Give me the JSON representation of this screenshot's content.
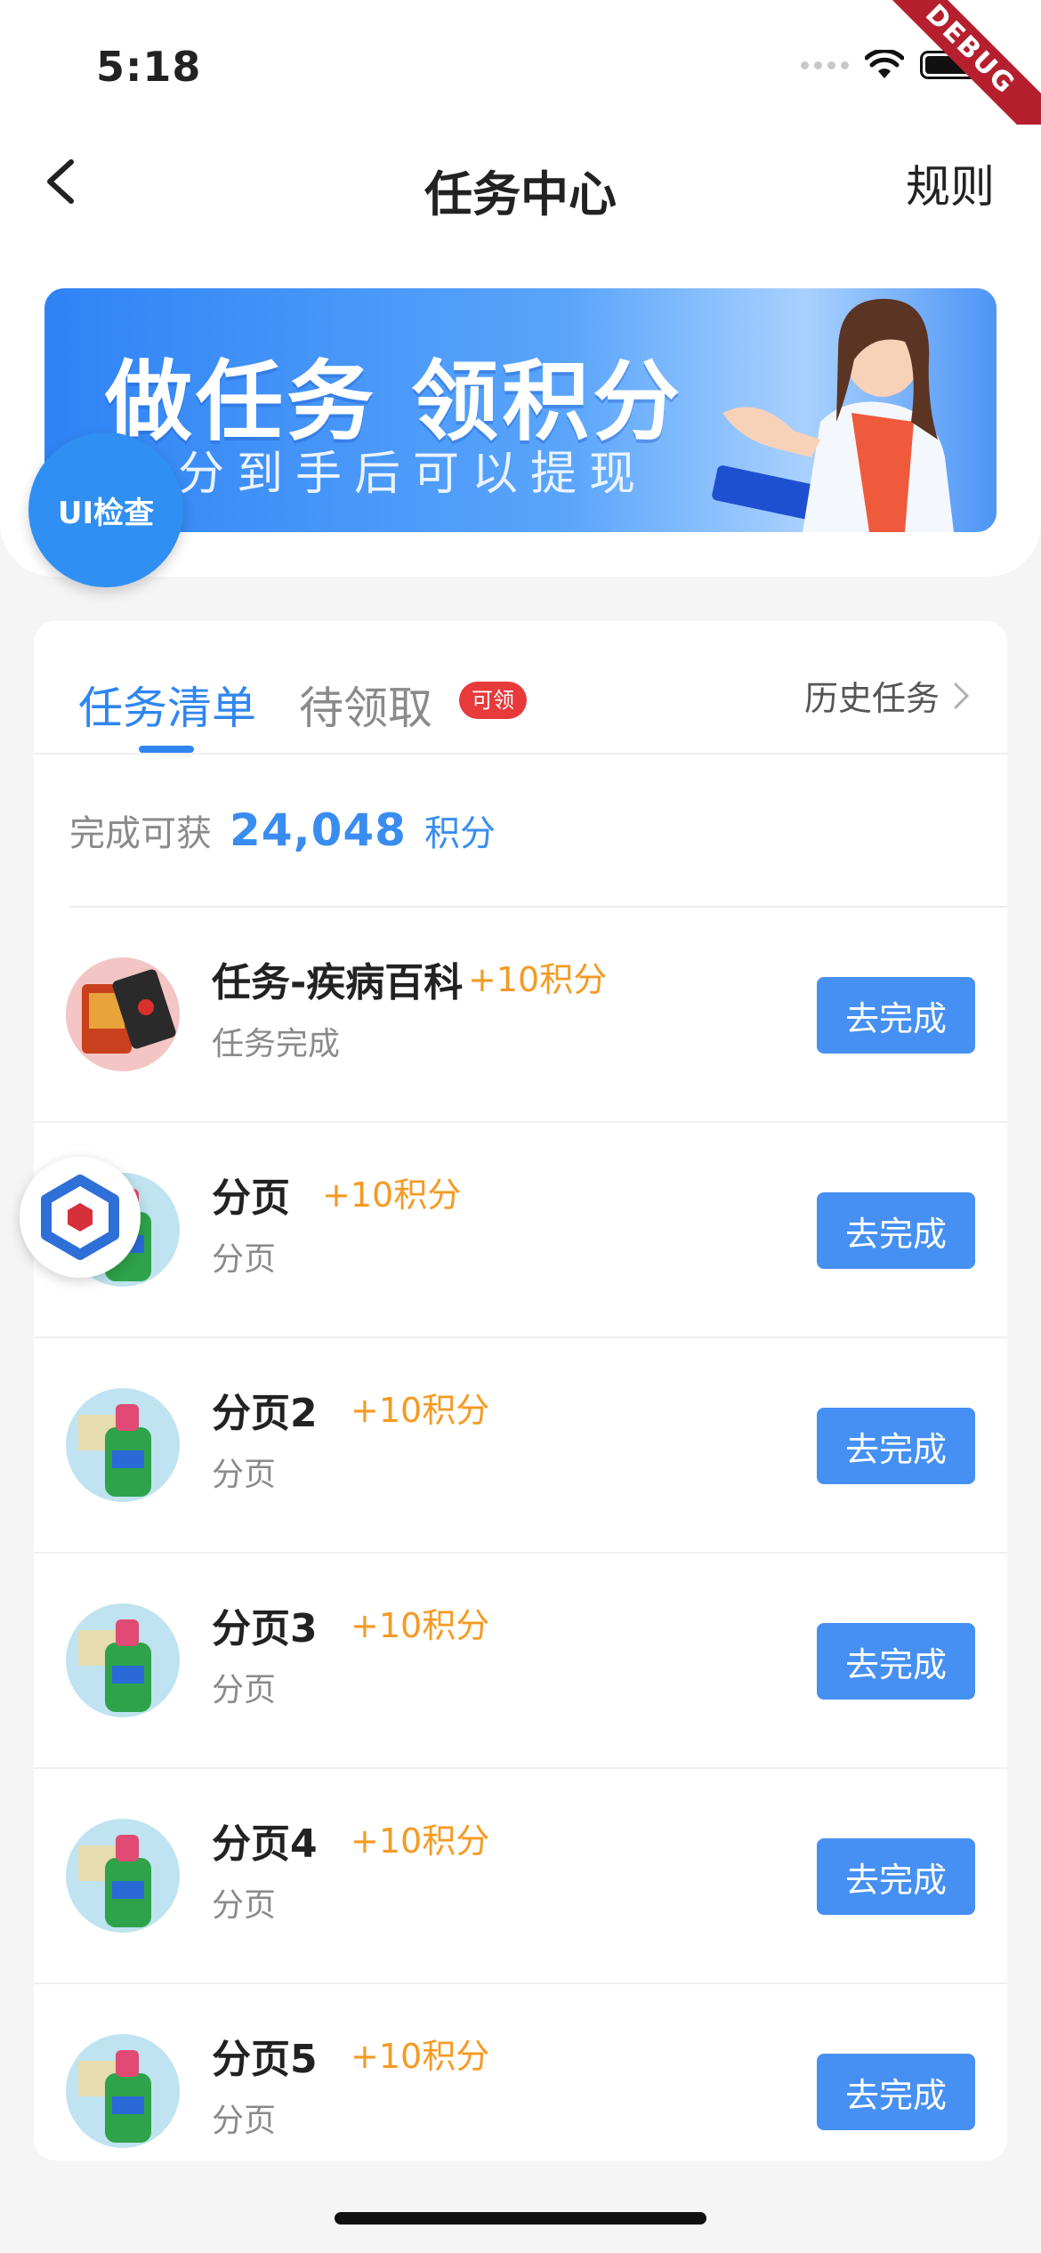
{
  "status_bar": {
    "time": "5:18",
    "debug_label": "DEBUG"
  },
  "nav": {
    "title": "任务中心",
    "rule_label": "规则"
  },
  "banner": {
    "title": "做任务 领积分",
    "subtitle": "分到手后可以提现"
  },
  "floating": {
    "ui_check_label": "UI检查"
  },
  "tabs": {
    "active_label": "任务清单",
    "pending_label": "待领取",
    "pending_badge": "可领",
    "history_label": "历史任务"
  },
  "summary": {
    "label": "完成可获",
    "points": "24,048",
    "unit": "积分"
  },
  "tasks": [
    {
      "title": "任务-疾病百科",
      "points": "+10积分",
      "subtitle": "任务完成",
      "button": "去完成",
      "thumb": "snack-thumb"
    },
    {
      "title": "分页",
      "points": "+10积分",
      "subtitle": "分页",
      "button": "去完成",
      "thumb": "detergent-thumb"
    },
    {
      "title": "分页2",
      "points": "+10积分",
      "subtitle": "分页",
      "button": "去完成",
      "thumb": "detergent-thumb"
    },
    {
      "title": "分页3",
      "points": "+10积分",
      "subtitle": "分页",
      "button": "去完成",
      "thumb": "detergent-thumb"
    },
    {
      "title": "分页4",
      "points": "+10积分",
      "subtitle": "分页",
      "button": "去完成",
      "thumb": "detergent-thumb"
    },
    {
      "title": "分页5",
      "points": "+10积分",
      "subtitle": "分页",
      "button": "去完成",
      "thumb": "detergent-thumb"
    }
  ],
  "colors": {
    "accent": "#2f86f0",
    "points_orange": "#f59a23",
    "badge_red": "#e8393b",
    "button_blue": "#4690f3"
  }
}
